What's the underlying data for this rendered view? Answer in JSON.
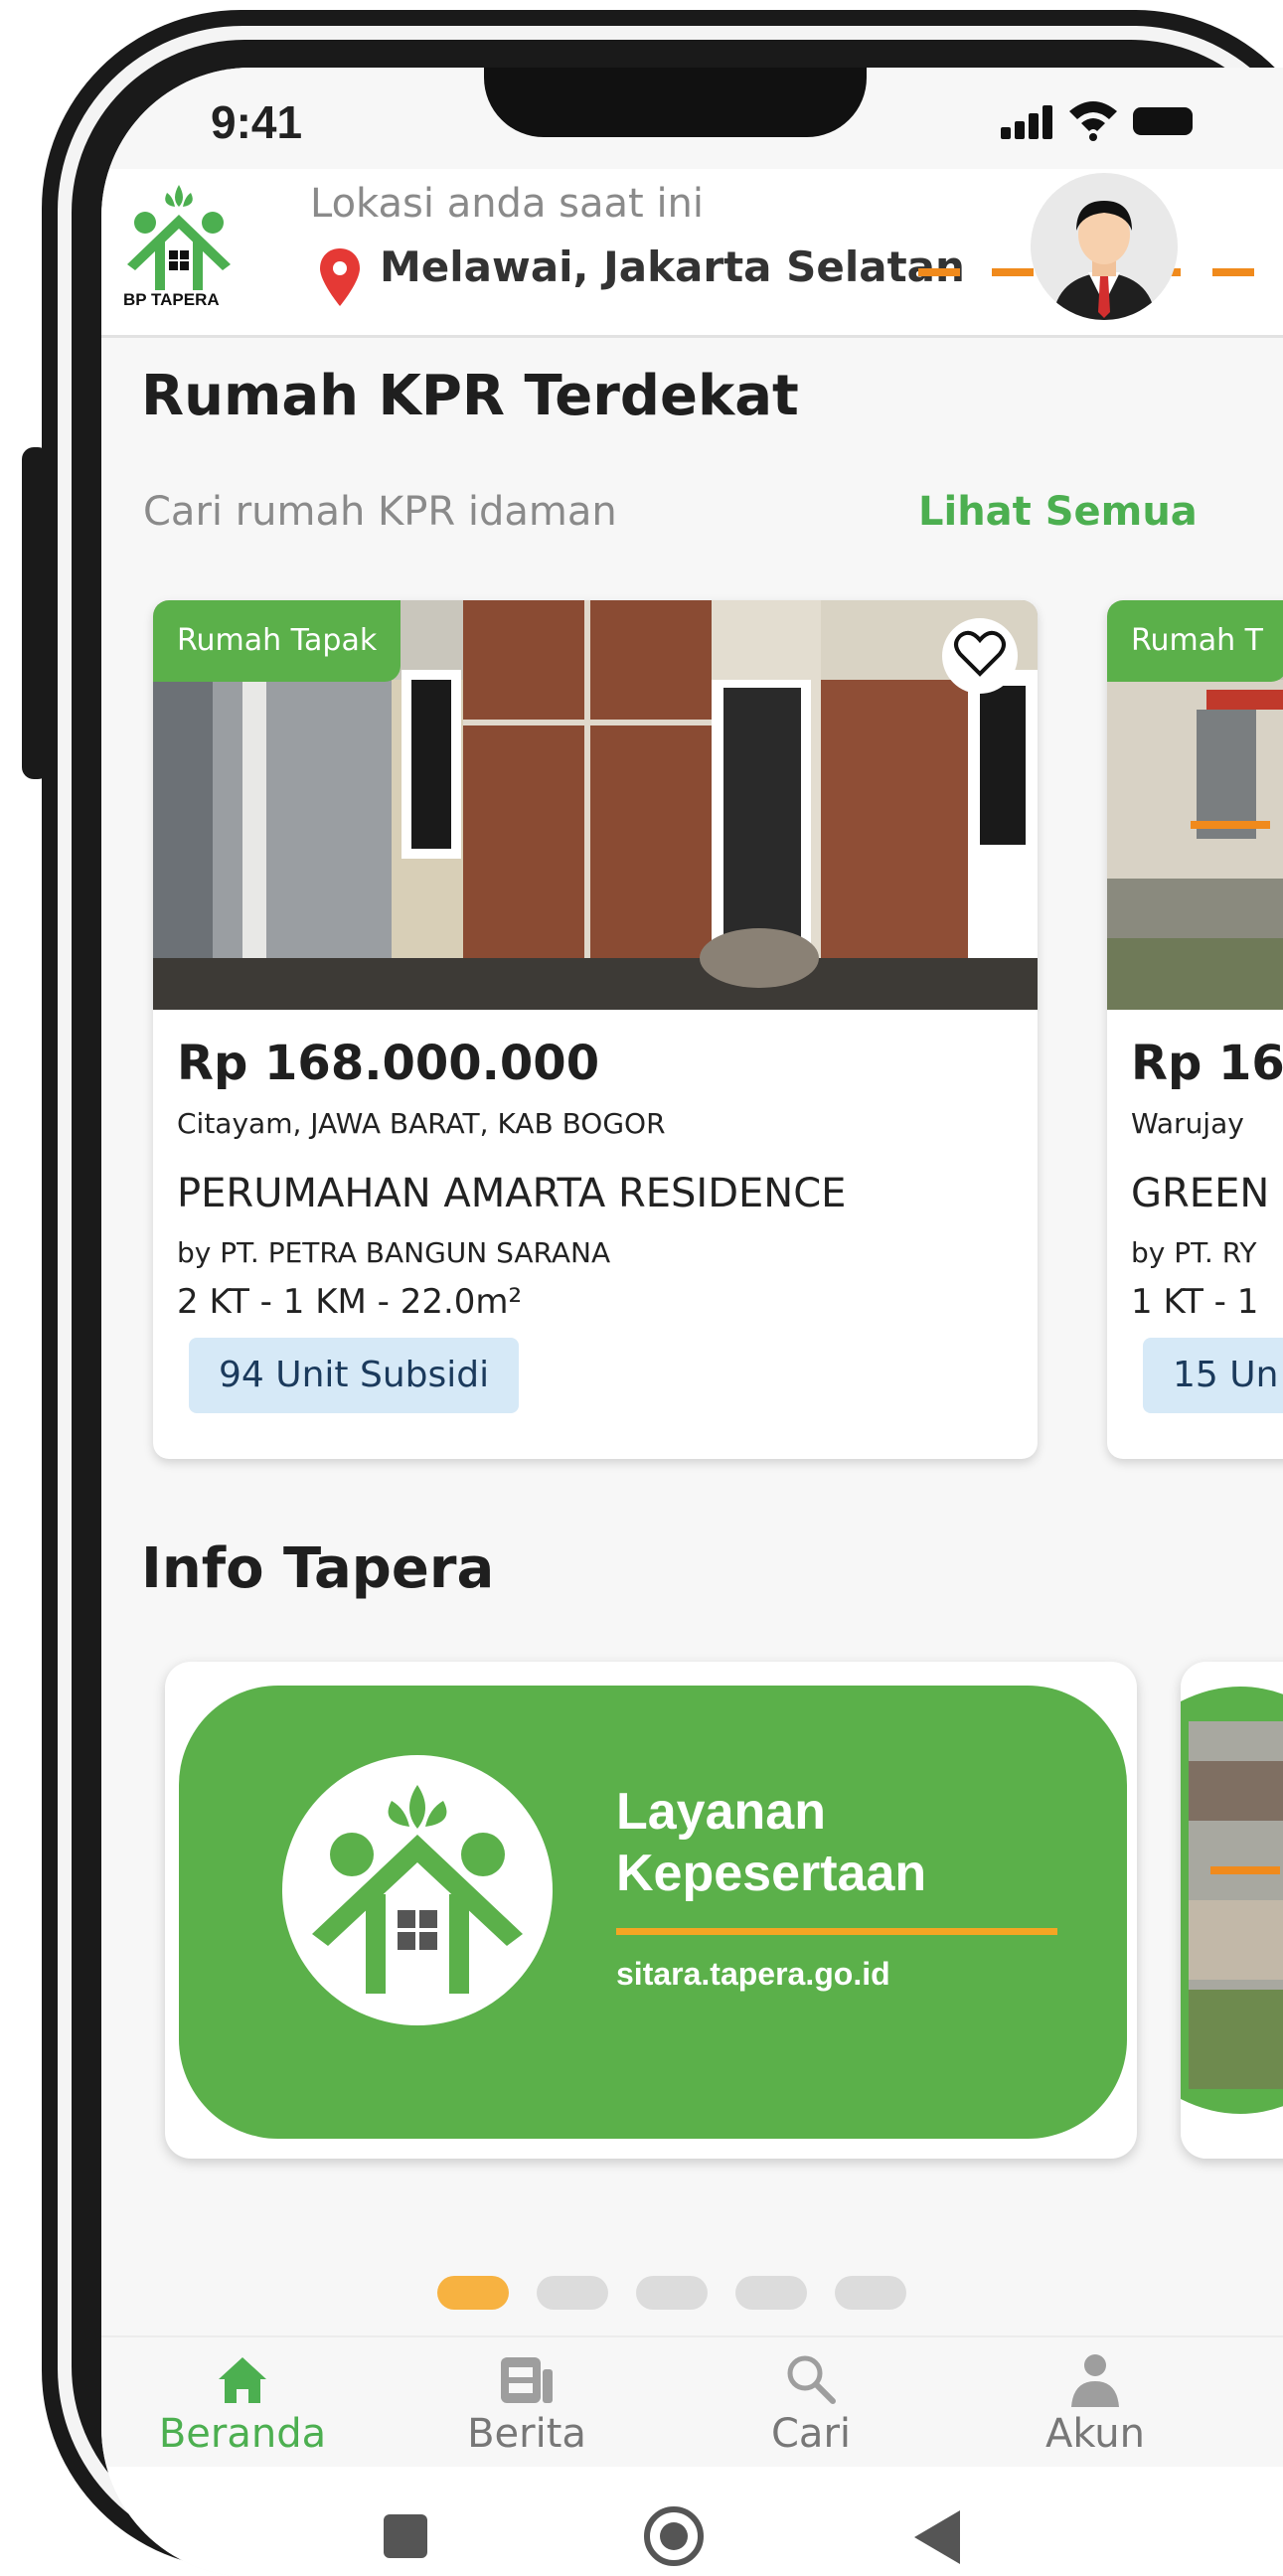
{
  "status_bar": {
    "time": "9:41"
  },
  "header": {
    "logo_text": "BP TAPERA",
    "location_label": "Lokasi anda saat ini",
    "location_value": "Melawai, Jakarta Selatan"
  },
  "kpr_section": {
    "title": "Rumah KPR Terdekat",
    "subtitle": "Cari rumah KPR idaman",
    "see_all": "Lihat Semua",
    "cards": [
      {
        "type": "Rumah Tapak",
        "price": "Rp 168.000.000",
        "location": "Citayam, JAWA BARAT, KAB BOGOR",
        "name": "PERUMAHAN AMARTA RESIDENCE",
        "developer": "by PT. PETRA BANGUN SARANA",
        "spec": "2 KT - 1 KM - 22.0m²",
        "units": "94 Unit Subsidi"
      },
      {
        "type": "Rumah T",
        "price": "Rp 16",
        "location": "Warujay",
        "name": "GREEN",
        "developer": "by PT. RY",
        "spec": "1 KT - 1",
        "units": "15 Un"
      }
    ]
  },
  "info_section": {
    "title": "Info Tapera",
    "banner_title_line1": "Layanan",
    "banner_title_line2": "Kepesertaan",
    "banner_url": "sitara.tapera.go.id"
  },
  "carousel": {
    "count": 5,
    "active_index": 0
  },
  "bottom_nav": {
    "items": [
      {
        "label": "Beranda",
        "icon": "home-icon",
        "active": true
      },
      {
        "label": "Berita",
        "icon": "news-icon",
        "active": false
      },
      {
        "label": "Cari",
        "icon": "search-icon",
        "active": false
      },
      {
        "label": "Akun",
        "icon": "account-icon",
        "active": false
      }
    ]
  },
  "colors": {
    "brand_green": "#4caf50",
    "badge_green": "#5bb04a",
    "accent_orange": "#f08a1c",
    "dot_active": "#f7b241",
    "unit_badge_bg": "#d6e9f7"
  }
}
